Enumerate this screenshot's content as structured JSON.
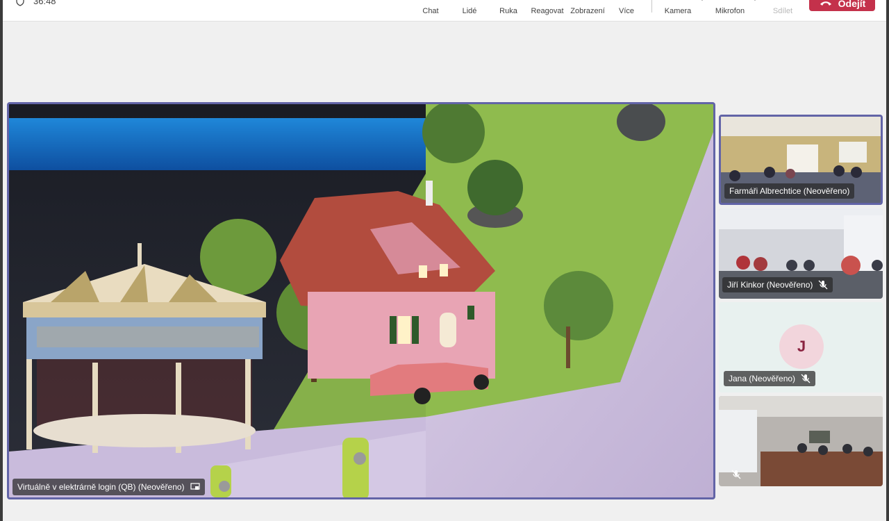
{
  "toolbar": {
    "timer": "36:48",
    "chat": "Chat",
    "people": "Lidé",
    "hand": "Ruka",
    "react": "Reagovat",
    "view": "Zobrazení",
    "more": "Více",
    "camera": "Kamera",
    "mic": "Mikrofon",
    "share": "Sdílet",
    "leave": "Odejít"
  },
  "stage": {
    "participant": "Virtuálně v elektrárně login (QB) (Neověřeno)"
  },
  "tiles": [
    {
      "name": "Farmáři Albrechtice (Neověřeno)"
    },
    {
      "name": "Jiří Kinkor (Neověřeno)"
    },
    {
      "name": "Jana (Neověřeno)",
      "initial": "J"
    },
    {
      "name": ""
    }
  ],
  "colors": {
    "accent": "#6264a7",
    "leave": "#c4314b"
  }
}
